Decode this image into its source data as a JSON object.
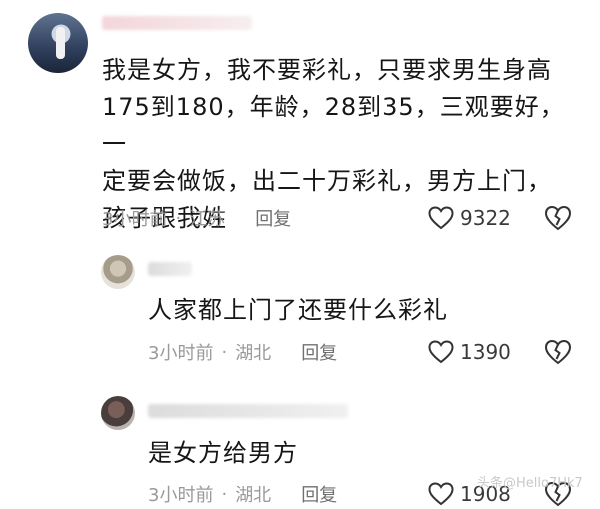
{
  "comments": [
    {
      "text_lines": [
        "我是女方，我不要彩礼，只要求男生身高",
        "175到180，年龄，28到35，三观要好，一",
        "定要会做饭，出二十万彩礼，男方上门，",
        "孩子跟我姓"
      ],
      "time": "3小时前",
      "location": "江苏",
      "reply_label": "回复",
      "likes": "9322"
    },
    {
      "text_lines": [
        "人家都上门了还要什么彩礼"
      ],
      "time": "3小时前",
      "location": "湖北",
      "reply_label": "回复",
      "likes": "1390"
    },
    {
      "text_lines": [
        "是女方给男方"
      ],
      "time": "3小时前",
      "location": "湖北",
      "reply_label": "回复",
      "likes": "1908"
    }
  ],
  "meta_separator": "·",
  "watermark": "头条@Hello7Hk7"
}
